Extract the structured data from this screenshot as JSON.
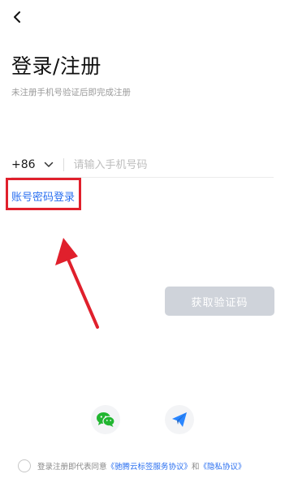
{
  "header": {
    "title": "登录/注册",
    "subtitle": "未注册手机号验证后即完成注册"
  },
  "phone": {
    "country_code": "+86",
    "placeholder": "请输入手机号码",
    "value": ""
  },
  "links": {
    "account_password_login": "账号密码登录"
  },
  "actions": {
    "get_code": "获取验证码"
  },
  "social": {
    "items": [
      "wechat-icon",
      "telegram-icon"
    ]
  },
  "agreement": {
    "prefix": "登录注册即代表同意",
    "service": "《驰腾云标签服务协议》",
    "and": "和",
    "privacy": "《隐私协议》"
  },
  "colors": {
    "accent": "#2a6ff0",
    "highlight": "#e0202c",
    "button_disabled": "#cfd3da",
    "wechat": "#21b630"
  }
}
